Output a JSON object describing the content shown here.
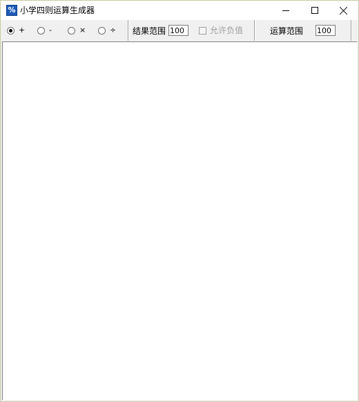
{
  "window": {
    "title": "小学四则运算生成器",
    "icon_text": "%"
  },
  "toolbar": {
    "operators": [
      {
        "label": "+",
        "checked": true
      },
      {
        "label": "-",
        "checked": false
      },
      {
        "label": "×",
        "checked": false
      },
      {
        "label": "÷",
        "checked": false
      }
    ],
    "result_range_label": "结果范围",
    "result_range_value": "100",
    "allow_negative_label": "允许负值",
    "allow_negative_checked": false,
    "allow_negative_enabled": false,
    "operand_range_label": "运算范围",
    "operand_range_value": "100"
  },
  "colors": {
    "background": "#f0f0f0",
    "content": "#ffffff",
    "disabled_text": "#a0a0a0"
  }
}
